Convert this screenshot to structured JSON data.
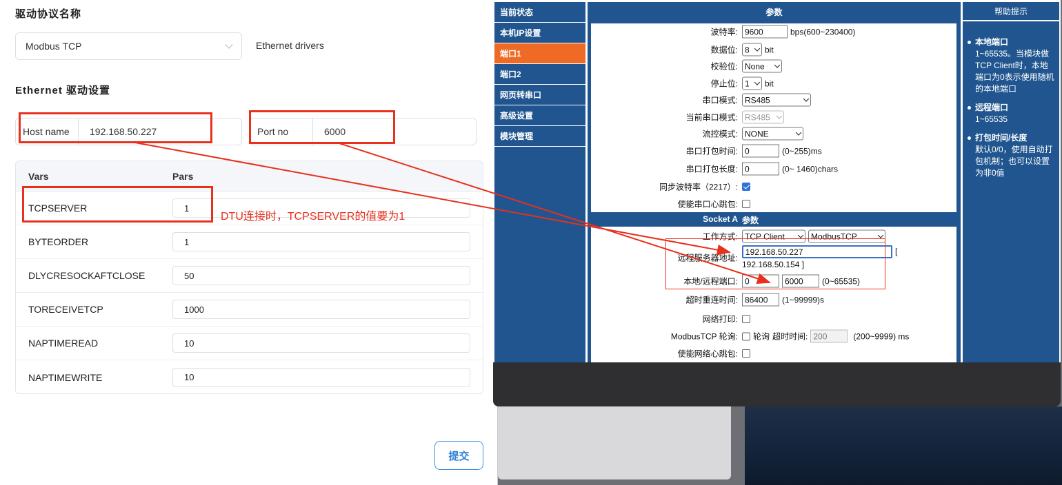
{
  "driver_panel": {
    "protocol_title": "驱动协议名称",
    "protocol_selected": "Modbus TCP",
    "protocol_note": "Ethernet drivers",
    "ethernet_title": "Ethernet 驱动设置",
    "host_label": "Host name",
    "host_value": "192.168.50.227",
    "port_label": "Port no",
    "port_value": "6000",
    "table": {
      "headers": [
        "Vars",
        "Pars"
      ],
      "rows": [
        {
          "var": "TCPSERVER",
          "par": "1"
        },
        {
          "var": "BYTEORDER",
          "par": "1"
        },
        {
          "var": "DLYCRESOCKAFTCLOSE",
          "par": "50"
        },
        {
          "var": "TORECEIVETCP",
          "par": "1000"
        },
        {
          "var": "NAPTIMEREAD",
          "par": "10"
        },
        {
          "var": "NAPTIMEWRITE",
          "par": "10"
        }
      ]
    },
    "submit_label": "提交"
  },
  "annotation_note": "DTU连接时，TCPSERVER的值要为1",
  "device": {
    "nav": [
      "当前状态",
      "本机IP设置",
      "端口1",
      "端口2",
      "网页转串口",
      "高级设置",
      "模块管理"
    ],
    "active_nav": 2,
    "params_title": "参数",
    "baud_label": "波特率:",
    "baud_value": "9600",
    "baud_hint": "bps(600~230400)",
    "databits_label": "数据位:",
    "databits_value": "8",
    "databits_unit": "bit",
    "parity_label": "校验位:",
    "parity_value": "None",
    "stopbits_label": "停止位:",
    "stopbits_value": "1",
    "stopbits_unit": "bit",
    "serial_mode_label": "串口模式:",
    "serial_mode_value": "RS485",
    "current_mode_label": "当前串口模式:",
    "current_mode_value": "RS485",
    "flow_label": "流控模式:",
    "flow_value": "NONE",
    "pack_time_label": "串口打包时间:",
    "pack_time_value": "0",
    "pack_time_hint": "(0~255)ms",
    "pack_len_label": "串口打包长度:",
    "pack_len_value": "0",
    "pack_len_hint": "(0~ 1460)chars",
    "sync_baud_label": "同步波特率（2217）:",
    "heartbeat_label": "使能串口心跳包:",
    "socket_left": "Socket A",
    "socket_right": "参数",
    "work_mode_label": "工作方式:",
    "work_mode_value": "TCP Client",
    "work_proto_value": "ModbusTCP",
    "remote_addr_label": "远程服务器地址:",
    "remote_addr_value": "192.168.50.227",
    "remote_addr_extra": "192.168.50.154 ]",
    "remote_addr_bracket": "[",
    "port_label": "本地/远程端口:",
    "local_port_value": "0",
    "remote_port_value": "6000",
    "port_hint": "(0~65535)",
    "reconnect_label": "超时重连时间:",
    "reconnect_value": "86400",
    "reconnect_hint": "(1~99999)s",
    "net_print_label": "网络打印:",
    "modbus_poll_label": "ModbusTCP 轮询:",
    "poll_text": "轮询",
    "timeout_label": "超时时间:",
    "timeout_value": "200",
    "timeout_hint": "(200~9999) ms",
    "net_heartbeat_label": "使能网络心跳包:"
  },
  "help": {
    "title": "帮助提示",
    "items": [
      {
        "title": "本地端口",
        "body": "1~65535。当模块做TCP Client时，本地端口为0表示使用随机的本地端口"
      },
      {
        "title": "远程端口",
        "body": "1~65535"
      },
      {
        "title": "打包时间/长度",
        "body": "默认0/0，使用自动打包机制；也可以设置为非0值"
      }
    ]
  },
  "colors": {
    "nav_blue": "#20558f",
    "active_orange": "#ef6a24",
    "annotation_red": "#e8301c",
    "button_blue": "#2f80d8"
  }
}
